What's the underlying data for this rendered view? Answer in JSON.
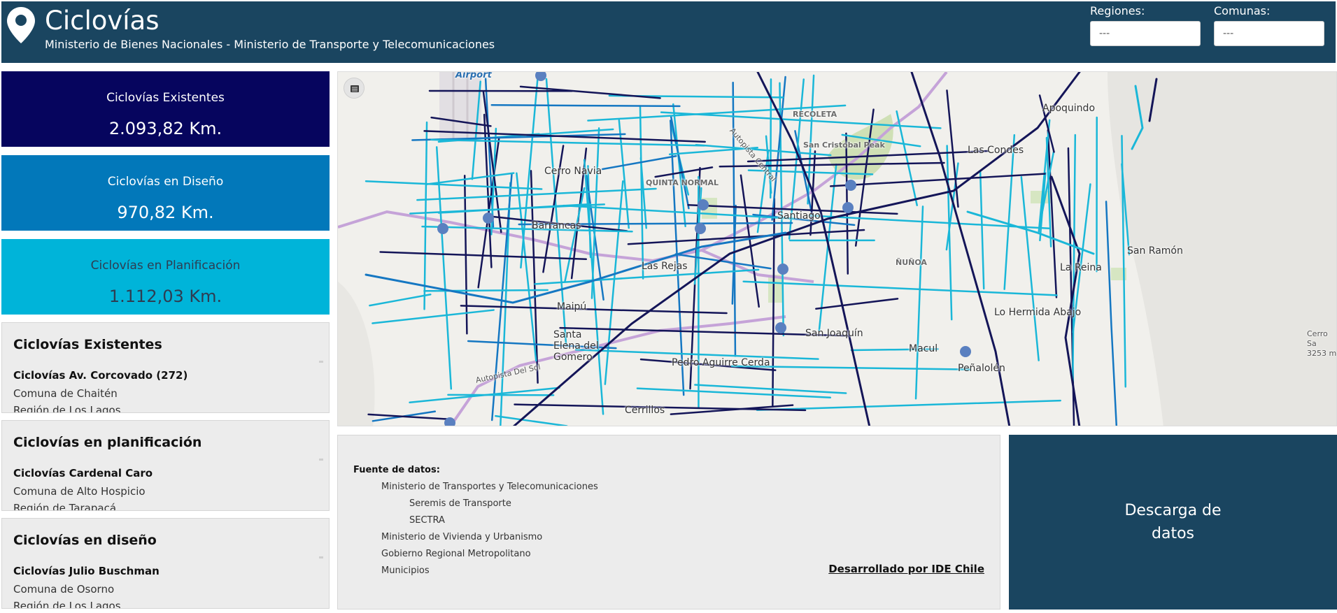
{
  "header": {
    "title": "Ciclovías",
    "subtitle": "Ministerio de Bienes Nacionales - Ministerio de Transporte y Telecomunicaciones",
    "filters": [
      {
        "label": "Regiones:",
        "value": "---"
      },
      {
        "label": "Comunas:",
        "value": "---"
      }
    ]
  },
  "stats": [
    {
      "label": "Ciclovías Existentes",
      "value": "2.093,82 Km.",
      "color": "#06055e"
    },
    {
      "label": "Ciclovías en Diseño",
      "value": "970,82 Km.",
      "color": "#0278ba"
    },
    {
      "label": "Ciclovías en Planificación",
      "value": "1.112,03 Km.",
      "color": "#00b4d9"
    }
  ],
  "lists": [
    {
      "title": "Ciclovías Existentes",
      "item": {
        "name": "Ciclovías Av. Corcovado (272)",
        "comuna": "Comuna de Chaitén",
        "region": "Región de Los Lagos"
      }
    },
    {
      "title": "Ciclovías en planificación",
      "item": {
        "name": "Ciclovías Cardenal Caro",
        "comuna": "Comuna de Alto Hospicio",
        "region": "Región de Tarapacá"
      }
    },
    {
      "title": "Ciclovías en diseño",
      "item": {
        "name": "Ciclovías Julio Buschman",
        "comuna": "Comuna de Osorno",
        "region": "Región de Los Lagos"
      }
    }
  ],
  "map": {
    "layer_icon": "list-icon",
    "labels": {
      "airport": "Airport",
      "recoleta": "RECOLETA",
      "apoquindo": "Apoquindo",
      "sancristobal": "San Cristóbal Peak",
      "cerronavia": "Cerro Navia",
      "quintanormal": "QUINTA NORMAL",
      "lascondes": "Las Condes",
      "santiago": "Santiago",
      "barrancas": "Barrancas",
      "sanramon": "San Ramón",
      "lasrejas": "Las Rejas",
      "nunoa": "ÑUÑOA",
      "lareina": "La Reina",
      "maipu": "Maipú",
      "lohermida": "Lo Hermida Abajo",
      "santaelena": "Santa Elena del Gomero",
      "sanjoaquin": "San Joaquín",
      "macul": "Macul",
      "cerro": "Cerro Sa 3253 m",
      "pac": "Pedro Aguirre Cerda",
      "penalolen": "Peñalolén",
      "cerrillos": "Cerrillos",
      "autopista": "Autopista Del Sol",
      "autopistacentral": "Autopista Central"
    },
    "colors": {
      "existing": "#141558",
      "design": "#1577c2",
      "planning": "#1ab7d8",
      "highway": "#c5a3d8"
    }
  },
  "sources": {
    "title": "Fuente de datos:",
    "items": [
      "Ministerio de Transportes y Telecomunicaciones",
      "Seremis de Transporte",
      "SECTRA",
      "Ministerio de Vivienda y Urbanismo",
      "Gobierno Regional Metropolitano",
      "Municipios"
    ],
    "developer_link": "Desarrollado por IDE Chile"
  },
  "download": {
    "label": "Descarga de datos"
  }
}
